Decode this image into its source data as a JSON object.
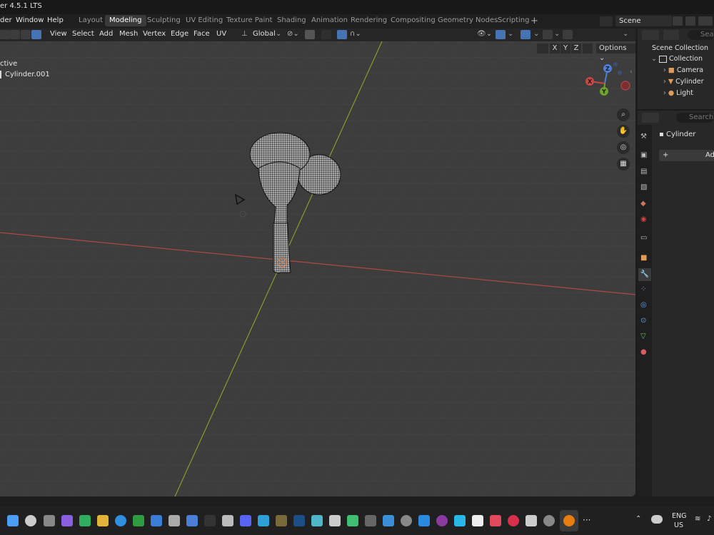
{
  "app": {
    "title": "er 4.5.1 LTS"
  },
  "menu": {
    "items": [
      "der",
      "Window",
      "Help"
    ]
  },
  "workspaces": [
    "Layout",
    "Modeling",
    "Sculpting",
    "UV Editing",
    "Texture Paint",
    "Shading",
    "Animation",
    "Rendering",
    "Compositing",
    "Geometry Nodes",
    "Scripting"
  ],
  "active_workspace": "Modeling",
  "scene": {
    "name": "Scene"
  },
  "header": {
    "menus": [
      "View",
      "Select",
      "Add",
      "Mesh",
      "Vertex",
      "Edge",
      "Face",
      "UV"
    ],
    "transform_orientation": "Global",
    "axes": [
      "X",
      "Y",
      "Z"
    ],
    "options_label": "Options"
  },
  "viewport": {
    "mode_text": "ctive",
    "object_name": "Cylinder.001",
    "gizmo": {
      "x": "X",
      "y": "Y",
      "z": "Z"
    }
  },
  "outliner": {
    "search_placeholder": "Sea",
    "scene_collection": "Scene Collection",
    "collection": "Collection",
    "items": [
      "Camera",
      "Cylinder",
      "Light"
    ]
  },
  "properties": {
    "search_placeholder": "Search",
    "object": "Cylinder",
    "add_label": "Ad"
  },
  "taskbar": {
    "lang": "ENG",
    "region": "US",
    "dots": "···"
  },
  "colors": {
    "accent": "#4772b3",
    "viewport_bg": "#3d3d3d",
    "x_axis": "#b04848",
    "y_axis": "#7f9f2d"
  }
}
